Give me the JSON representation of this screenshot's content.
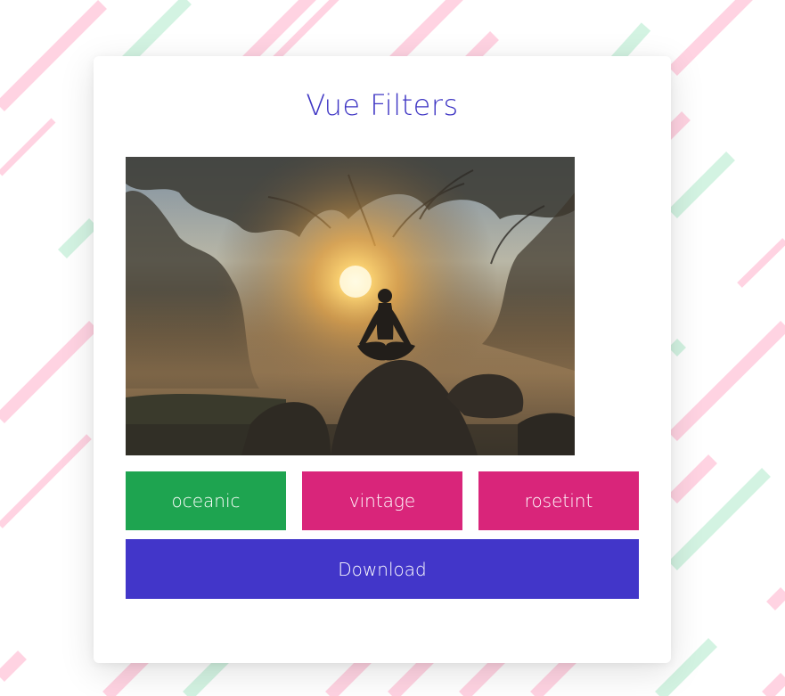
{
  "app": {
    "title": "Vue Filters"
  },
  "image": {
    "alt": "Silhouette of a person meditating on a rock at sunrise among misty trees",
    "icon": "photo"
  },
  "filters": [
    {
      "label": "oceanic",
      "color": "#1ea450"
    },
    {
      "label": "vintage",
      "color": "#d9257a"
    },
    {
      "label": "rosetint",
      "color": "#d9257a"
    }
  ],
  "actions": {
    "download_label": "Download",
    "download_color": "#4236c9"
  },
  "theme": {
    "accent": "#3f36c4",
    "stripe_pink": "#ffcfe0",
    "stripe_green": "#cff2df",
    "background": "#ffffff"
  }
}
